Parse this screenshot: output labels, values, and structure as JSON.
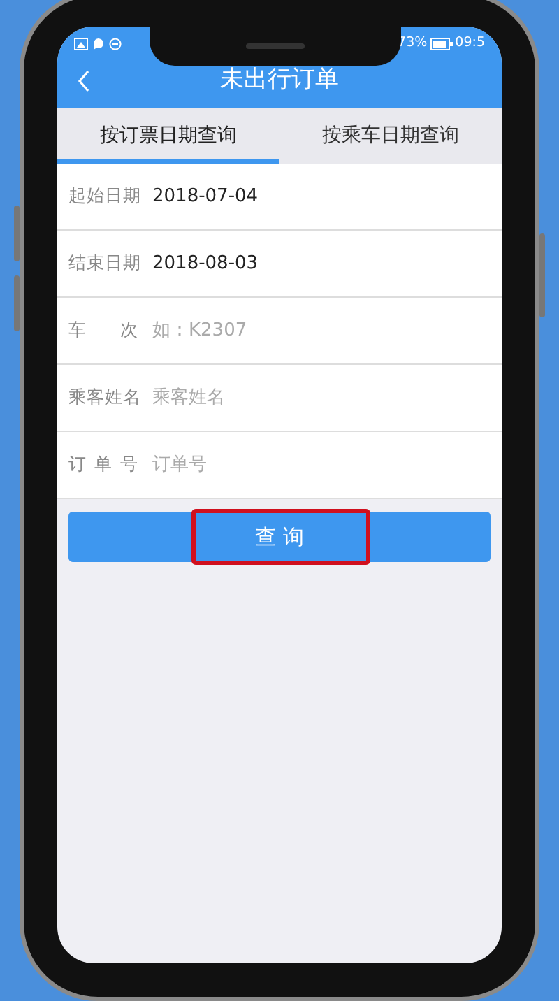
{
  "status_bar": {
    "battery": "73%",
    "time": "09:5"
  },
  "header": {
    "title": "未出行订单"
  },
  "tabs": [
    {
      "label": "按订票日期查询",
      "selected": true
    },
    {
      "label": "按乘车日期查询",
      "selected": false
    }
  ],
  "fields": [
    {
      "label": "起始日期",
      "value": "2018-07-04"
    },
    {
      "label": "结束日期",
      "value": "2018-08-03"
    },
    {
      "label": "车 次",
      "placeholder": "如：K2307"
    },
    {
      "label": "乘客姓名",
      "placeholder": "乘客姓名"
    },
    {
      "label": "订 单 号",
      "placeholder": "订单号"
    }
  ],
  "search_button": {
    "label": "查 询"
  }
}
